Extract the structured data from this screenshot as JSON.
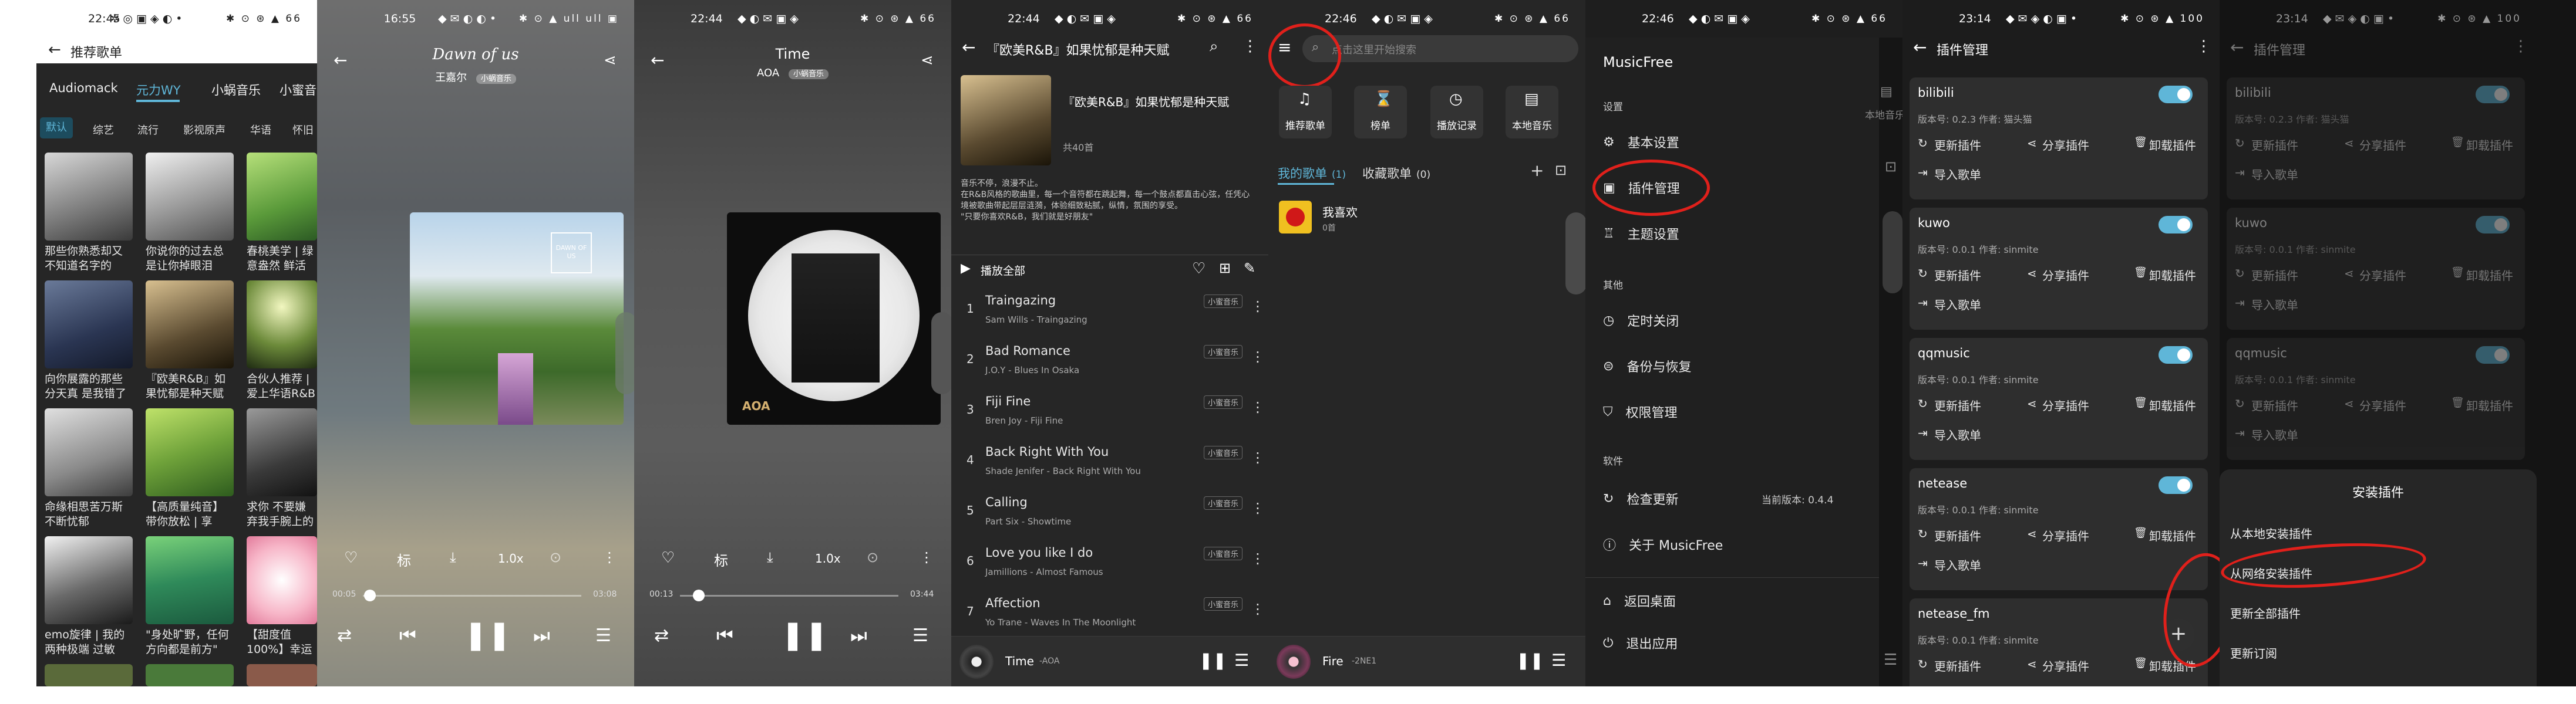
{
  "accent": "#5fb6d8",
  "annotation_color": "#e0201b",
  "phone1": {
    "status": {
      "time": "22:45",
      "icons": "✲ ◎ ▣ ◈ ◐ •",
      "right": "✱ ⊙ ⊛ ▲ 66"
    },
    "title": "推荐歌单",
    "tabs": [
      "Audiomack",
      "元力WY",
      "小蜗音乐",
      "小蜜音乐"
    ],
    "chips": [
      "默认",
      "综艺",
      "流行",
      "影视原声",
      "华语",
      "怀旧"
    ],
    "captions": [
      "那些你熟悉却又不知道名字的轻...",
      "你说你的过去总是让你掉眼泪",
      "春桃美学 | 绿意盎然 鲜活 生...",
      "向你展露的那些分天真 是我错了",
      "『欧美R&B』如果忧郁是种天赋",
      "合伙人推荐 | 爱上华语R&B这辈...",
      "命缘相思苦万斯不断忧郁",
      "【高质量纯音】带你放松 | 享受...",
      "求你 不要嫌弃我手腕上的稻和发...",
      "emo旋律 | 我的两种极端 过敏分...",
      "\"身处旷野，任何方向都是前方\"",
      "【甜度值100%】幸运降临 甜蜜登..."
    ]
  },
  "phone2": {
    "status": {
      "time": "16:55",
      "icons": "◆ ✉ ◐ ◐ •",
      "right": "✱ ⊙ ▲ ull ull ▣"
    },
    "song_title": "Dawn of us",
    "artist": "王嘉尔",
    "source": "小蜗音乐",
    "cover_text": "DAWN OF US",
    "time_now": "00:05",
    "time_total": "03:08",
    "speed": "1.0x",
    "lyric_btn": "标"
  },
  "phone3": {
    "status": {
      "time": "22:44",
      "icons": "◆ ◐ ✉ ▣ ◈",
      "right": "✱ ⊙ ⊛ ▲ 66"
    },
    "song_title": "Time",
    "artist": "AOA",
    "source": "小蜗音乐",
    "cover_text": "AOA",
    "time_now": "00:13",
    "time_total": "03:44",
    "speed": "1.0x",
    "lyric_btn": "标"
  },
  "phone4": {
    "status": {
      "time": "22:44",
      "icons": "◆ ◐ ✉ ▣ ◈",
      "right": "✱ ⊙ ⊛ ▲ 66"
    },
    "header": "『欧美R&B』如果忧郁是种天赋",
    "sheet_title": "『欧美R&B』如果忧郁是种天赋",
    "count": "共40首",
    "desc": "音乐不停，浪漫不止。\n在R&B风格的歌曲里，每一个音符都在跳起舞，每一个鼓点都直击心弦，任凭心境被歌曲带起层层涟漪，体验细致粘腻，纵情，氛围的享受。\n\"只要你喜欢R&B，我们就是好朋友\"",
    "play_all": "播放全部",
    "songs": [
      {
        "n": "1",
        "t": "Traingazing",
        "s": "Sam Wills - Traingazing",
        "tag": "小蜜音乐"
      },
      {
        "n": "2",
        "t": "Bad Romance",
        "s": "J.O.Y - Blues In Osaka",
        "tag": "小蜜音乐"
      },
      {
        "n": "3",
        "t": "Fiji Fine",
        "s": "Bren Joy - Fiji Fine",
        "tag": "小蜜音乐"
      },
      {
        "n": "4",
        "t": "Back Right With You",
        "s": "Shade Jenifer - Back Right With You",
        "tag": "小蜜音乐"
      },
      {
        "n": "5",
        "t": "Calling",
        "s": "Part Six - Showtime",
        "tag": "小蜜音乐"
      },
      {
        "n": "6",
        "t": "Love you like I do",
        "s": "Jamillions - Almost Famous",
        "tag": "小蜜音乐"
      },
      {
        "n": "7",
        "t": "Affection",
        "s": "Yo Trane - Waves In The Moonlight",
        "tag": "小蜜音乐"
      }
    ],
    "mini_title": "Time",
    "mini_artist": "-AOA"
  },
  "phone5": {
    "status": {
      "time": "22:46",
      "icons": "◆ ◐ ✉ ▣ ◈",
      "right": "✱ ⊙ ⊛ ▲ 66"
    },
    "search_placeholder": "点击这里开始搜索",
    "quick": [
      "推荐歌单",
      "榜单",
      "播放记录",
      "本地音乐"
    ],
    "my_tab": "我的歌单",
    "my_count": "(1)",
    "fav_tab": "收藏歌单",
    "fav_count": "(0)",
    "fav_name": "我喜欢",
    "fav_sub": "0首",
    "mini_title": "Fire",
    "mini_artist": "-2NE1"
  },
  "phone6": {
    "status": {
      "time": "22:46",
      "icons": "◆ ◐ ✉ ▣ ◈",
      "right": "✱ ⊙ ⊛ ▲ 66"
    },
    "app": "MusicFree",
    "sec_settings": "设置",
    "items1": [
      "基本设置",
      "插件管理",
      "主题设置"
    ],
    "sec_other": "其他",
    "items2": [
      "定时关闭",
      "备份与恢复",
      "权限管理"
    ],
    "sec_soft": "软件",
    "items3": [
      "检查更新",
      "关于 MusicFree"
    ],
    "version": "当前版本: 0.4.4",
    "items4": [
      "返回桌面",
      "退出应用"
    ],
    "peek_local": "本地音乐"
  },
  "phone7": {
    "status": {
      "time": "23:14",
      "icons": "◆ ✉ ◈ ◐ ▣ •",
      "right": "✱ ⊙ ⊛ ▲ 100"
    },
    "title": "插件管理",
    "plugins": [
      {
        "name": "bilibili",
        "ver": "版本号: 0.2.3",
        "author": "作者: 猫头猫"
      },
      {
        "name": "kuwo",
        "ver": "版本号: 0.0.1",
        "author": "作者: sinmite"
      },
      {
        "name": "qqmusic",
        "ver": "版本号: 0.0.1",
        "author": "作者: sinmite"
      },
      {
        "name": "netease",
        "ver": "版本号: 0.0.1",
        "author": "作者: sinmite"
      },
      {
        "name": "netease_fm",
        "ver": "版本号: 0.0.1",
        "author": "作者: sinmite"
      }
    ],
    "btn_update": "更新插件",
    "btn_share": "分享插件",
    "btn_uninstall": "卸载插件",
    "btn_import": "导入歌单"
  },
  "phone8": {
    "status": {
      "time": "23:14",
      "icons": "◆ ✉ ◈ ◐ ▣ •",
      "right": "✱ ⊙ ⊛ ▲ 100"
    },
    "title": "插件管理",
    "sheet_title": "安装插件",
    "options": [
      "从本地安装插件",
      "从网络安装插件",
      "更新全部插件",
      "更新订阅"
    ]
  }
}
